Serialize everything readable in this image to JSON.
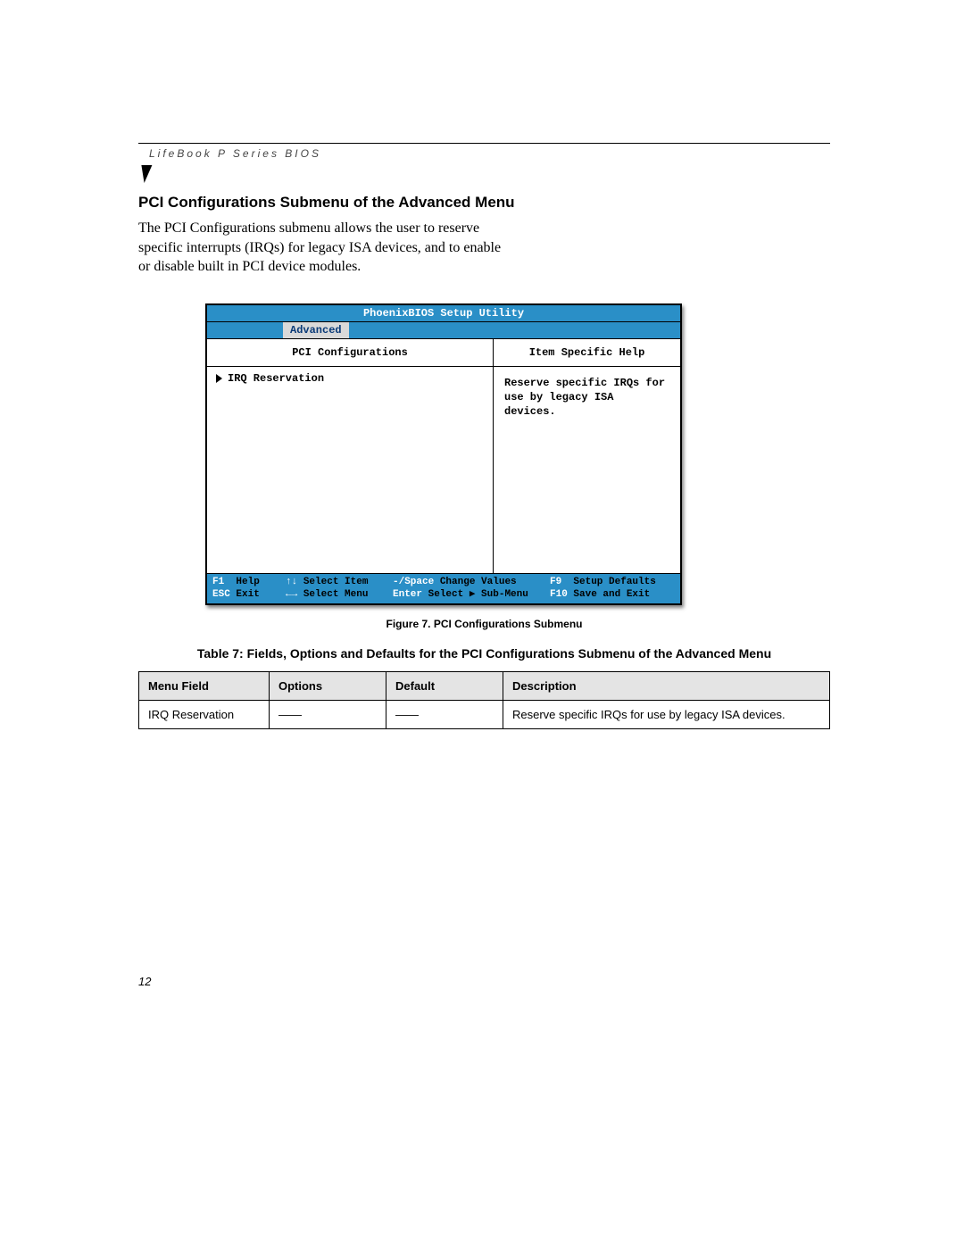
{
  "header": {
    "running_head": "LifeBook P Series BIOS"
  },
  "section": {
    "title": "PCI Configurations Submenu of the Advanced Menu",
    "body": "The PCI Configurations submenu allows the user to reserve specific interrupts (IRQs) for legacy ISA devices, and to enable or disable built in PCI device modules."
  },
  "bios": {
    "title": "PhoenixBIOS Setup Utility",
    "active_tab": "Advanced",
    "left_heading": "PCI Configurations",
    "submenu_item": "IRQ Reservation",
    "right_heading": "Item Specific Help",
    "help_text": "Reserve specific IRQs for use by legacy ISA devices.",
    "footer": {
      "r1c1_key": "F1",
      "r1c1_lbl": "Help",
      "r1c2_key": "↑↓",
      "r1c2_lbl": "Select Item",
      "r1c3_key": "-/Space",
      "r1c3_lbl": "Change Values",
      "r1c4_key": "F9",
      "r1c4_lbl": "Setup Defaults",
      "r2c1_key": "ESC",
      "r2c1_lbl": "Exit",
      "r2c2_key": "←→",
      "r2c2_lbl": "Select Menu",
      "r2c3_key": "Enter",
      "r2c3_lbl": "Select ▶ Sub-Menu",
      "r2c4_key": "F10",
      "r2c4_lbl": "Save and Exit"
    }
  },
  "figure_caption": "Figure 7.  PCI Configurations Submenu",
  "table_caption": "Table 7: Fields, Options and Defaults for the PCI Configurations Submenu of the Advanced Menu",
  "table": {
    "headers": [
      "Menu Field",
      "Options",
      "Default",
      "Description"
    ],
    "row": {
      "menu_field": "IRQ Reservation",
      "options": "——",
      "default_": "——",
      "description": "Reserve specific IRQs for use by legacy ISA devices."
    }
  },
  "page_number": "12"
}
